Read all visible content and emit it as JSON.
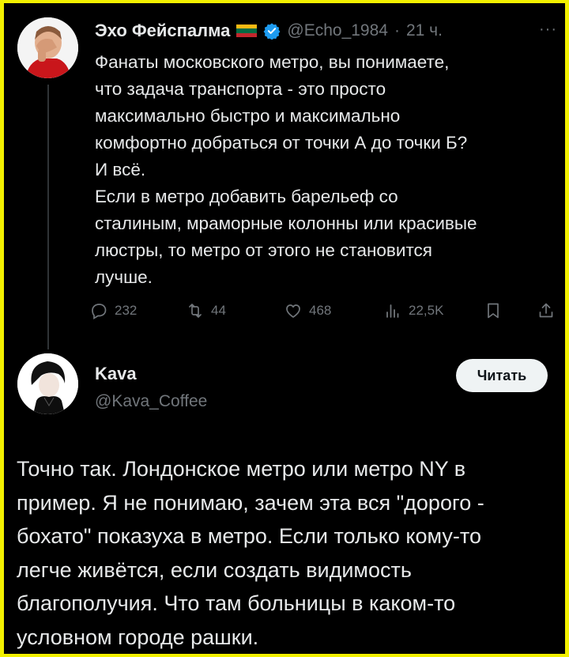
{
  "colors": {
    "frame_border": "#f2f000",
    "background": "#000000",
    "text_primary": "#e7e9ea",
    "text_secondary": "#71767b",
    "verified_blue": "#1d9bf0",
    "button_bg": "#eff3f4"
  },
  "tweet": {
    "author": {
      "display_name": "Эхо Фейспалма",
      "handle": "@Echo_1984",
      "flag_icon": "lithuania-flag-icon",
      "verified_icon": "verified-badge-icon"
    },
    "separator": "·",
    "time": "21 ч.",
    "more_label": "···",
    "text": "Фанаты московского метро, вы понимаете,\nчто задача транспорта - это просто\nмаксимально быстро и максимально\nкомфортно добраться от точки А до точки Б?\nИ всё.\nЕсли в метро добавить барельеф со\nсталиным, мраморные колонны или красивые\nлюстры, то метро от этого не становится\nлучше.",
    "metrics": {
      "replies": "232",
      "retweets": "44",
      "likes": "468",
      "views": "22,5K"
    }
  },
  "reply": {
    "author": {
      "display_name": "Kava",
      "handle": "@Kava_Coffee"
    },
    "follow_label": "Читать",
    "text": "Точно так. Лондонское метро или метро NY в\nпример. Я не понимаю, зачем эта вся \"дорого -\nбохато\" показуха в метро. Если только кому-то\nлегче живётся, если создать видимость\nблагополучия. Что там больницы в каком-то\nусловном  городе рашки."
  }
}
